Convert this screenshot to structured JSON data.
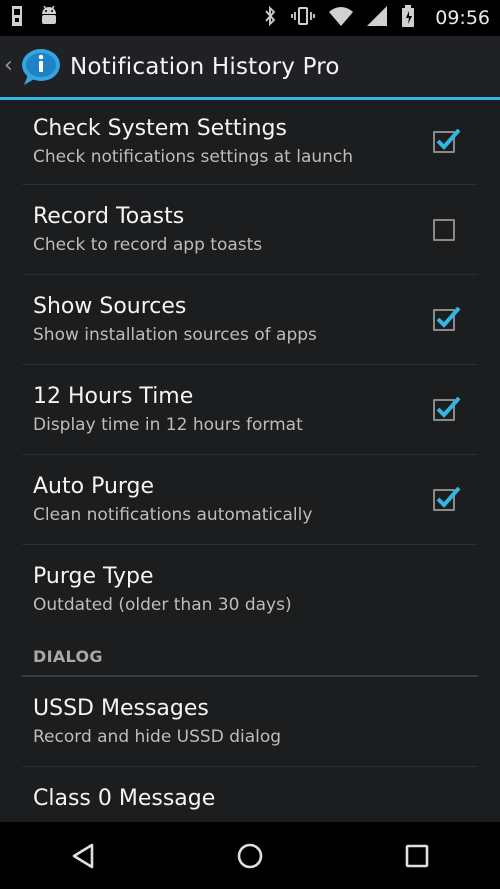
{
  "status_bar": {
    "time": "09:56",
    "left_icons": [
      "sd-card-icon",
      "android-icon"
    ],
    "right_icons": [
      "bluetooth-icon",
      "vibrate-icon",
      "wifi-icon",
      "signal-icon",
      "battery-icon"
    ]
  },
  "action_bar": {
    "title": "Notification History Pro",
    "accent_color": "#33b5e5"
  },
  "preferences": [
    {
      "title": "Check System Settings",
      "summary": "Check notifications settings at launch",
      "checked": true
    },
    {
      "title": "Record Toasts",
      "summary": "Check to record app toasts",
      "checked": false
    },
    {
      "title": "Show Sources",
      "summary": "Show installation sources of apps",
      "checked": true
    },
    {
      "title": "12 Hours Time",
      "summary": "Display time in 12 hours format",
      "checked": true
    },
    {
      "title": "Auto Purge",
      "summary": "Clean notifications automatically",
      "checked": true
    },
    {
      "title": "Purge Type",
      "summary": "Outdated (older than 30 days)",
      "checked": null
    }
  ],
  "dialog_category": {
    "label": "DIALOG",
    "items": [
      {
        "title": "USSD Messages",
        "summary": "Record and hide USSD dialog"
      },
      {
        "title": "Class 0 Message",
        "summary": ""
      }
    ]
  },
  "nav_bar": {
    "icons": [
      "back-icon",
      "home-icon",
      "recents-icon"
    ]
  }
}
